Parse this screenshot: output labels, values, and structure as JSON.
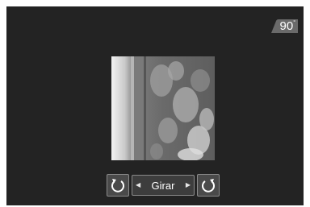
{
  "rotation": {
    "angle_value": "90",
    "angle_unit": "°",
    "mode_label": "Girar"
  },
  "icons": {
    "rotate_left": "rotate-counterclockwise-icon",
    "rotate_right": "rotate-clockwise-icon",
    "prev": "left-arrow-icon",
    "next": "right-arrow-icon"
  },
  "colors": {
    "screen_background": "#232323",
    "button_fill": "#4a4a4a",
    "button_border": "#8a8a8a",
    "text": "#ffffff"
  }
}
